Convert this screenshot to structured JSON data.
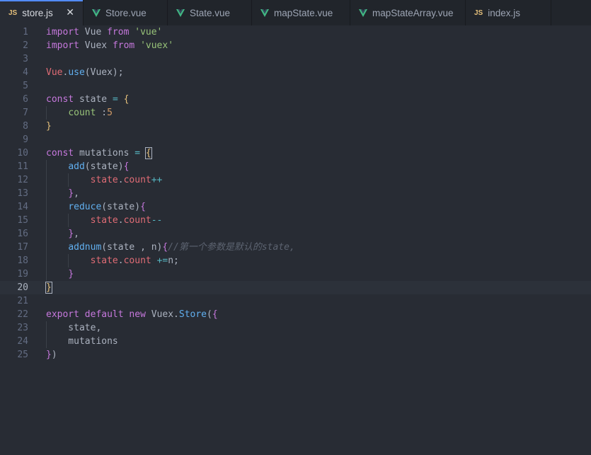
{
  "colors": {
    "editor_bg": "#282c34",
    "tabbar_bg": "#21252b",
    "keyword": "#c678dd",
    "string": "#98c379",
    "function": "#61afef",
    "property": "#e06c75",
    "number": "#d19a66",
    "operator": "#56b6c2",
    "comment": "#5c6370",
    "vue_green": "#41b883",
    "js_yellow": "#e5c07b"
  },
  "tabs": [
    {
      "label": "store.js",
      "icon": "js-icon",
      "icon_text": "JS",
      "active": true,
      "close_glyph": "✕"
    },
    {
      "label": "Store.vue",
      "icon": "vue-icon"
    },
    {
      "label": "State.vue",
      "icon": "vue-icon"
    },
    {
      "label": "mapState.vue",
      "icon": "vue-icon"
    },
    {
      "label": "mapStateArray.vue",
      "icon": "vue-icon"
    },
    {
      "label": "index.js",
      "icon": "js-icon",
      "icon_text": "JS"
    }
  ],
  "editor": {
    "current_line": 20,
    "lines": [
      {
        "n": "1",
        "tokens": [
          [
            "import",
            "keyword"
          ],
          [
            " Vue ",
            "plain"
          ],
          [
            "from",
            "keyword"
          ],
          [
            " ",
            "plain"
          ],
          [
            "'vue'",
            "string"
          ]
        ]
      },
      {
        "n": "2",
        "tokens": [
          [
            "import",
            "keyword"
          ],
          [
            " Vuex ",
            "plain"
          ],
          [
            "from",
            "keyword"
          ],
          [
            " ",
            "plain"
          ],
          [
            "'vuex'",
            "string"
          ]
        ]
      },
      {
        "n": "3",
        "tokens": []
      },
      {
        "n": "4",
        "tokens": [
          [
            "Vue",
            "prop"
          ],
          [
            ".",
            "plain"
          ],
          [
            "use",
            "func"
          ],
          [
            "(Vuex);",
            "plain"
          ]
        ]
      },
      {
        "n": "5",
        "tokens": []
      },
      {
        "n": "6",
        "tokens": [
          [
            "const",
            "keyword"
          ],
          [
            " state ",
            "plain"
          ],
          [
            "=",
            "op"
          ],
          [
            " ",
            "plain"
          ],
          [
            "{",
            "brace-yellow"
          ]
        ]
      },
      {
        "n": "7",
        "indent": 1,
        "tokens": [
          [
            "    ",
            "plain"
          ],
          [
            "count",
            "string"
          ],
          [
            " :",
            "plain"
          ],
          [
            "5",
            "number"
          ]
        ]
      },
      {
        "n": "8",
        "tokens": [
          [
            "}",
            "brace-yellow"
          ]
        ]
      },
      {
        "n": "9",
        "tokens": []
      },
      {
        "n": "10",
        "tokens": [
          [
            "const",
            "keyword"
          ],
          [
            " mutations ",
            "plain"
          ],
          [
            "=",
            "op"
          ],
          [
            " ",
            "plain"
          ],
          [
            "{",
            "brace-yellow"
          ]
        ]
      },
      {
        "n": "11",
        "indent": 1,
        "tokens": [
          [
            "    ",
            "plain"
          ],
          [
            "add",
            "func"
          ],
          [
            "(state)",
            "plain"
          ],
          [
            "{",
            "brace"
          ]
        ]
      },
      {
        "n": "12",
        "indent": 2,
        "tokens": [
          [
            "        ",
            "plain"
          ],
          [
            "state",
            "prop"
          ],
          [
            ".",
            "plain"
          ],
          [
            "count",
            "prop"
          ],
          [
            "++",
            "op"
          ]
        ]
      },
      {
        "n": "13",
        "indent": 1,
        "tokens": [
          [
            "    ",
            "plain"
          ],
          [
            "}",
            "brace"
          ],
          [
            ",",
            "plain"
          ]
        ]
      },
      {
        "n": "14",
        "indent": 1,
        "tokens": [
          [
            "    ",
            "plain"
          ],
          [
            "reduce",
            "func"
          ],
          [
            "(state)",
            "plain"
          ],
          [
            "{",
            "brace"
          ]
        ]
      },
      {
        "n": "15",
        "indent": 2,
        "tokens": [
          [
            "        ",
            "plain"
          ],
          [
            "state",
            "prop"
          ],
          [
            ".",
            "plain"
          ],
          [
            "count",
            "prop"
          ],
          [
            "--",
            "op"
          ]
        ]
      },
      {
        "n": "16",
        "indent": 1,
        "tokens": [
          [
            "    ",
            "plain"
          ],
          [
            "}",
            "brace"
          ],
          [
            ",",
            "plain"
          ]
        ]
      },
      {
        "n": "17",
        "indent": 1,
        "tokens": [
          [
            "    ",
            "plain"
          ],
          [
            "addnum",
            "func"
          ],
          [
            "(state , n)",
            "plain"
          ],
          [
            "{",
            "brace"
          ],
          [
            "//第一个参数是默认的state,",
            "comment"
          ]
        ]
      },
      {
        "n": "18",
        "indent": 2,
        "tokens": [
          [
            "        ",
            "plain"
          ],
          [
            "state",
            "prop"
          ],
          [
            ".",
            "plain"
          ],
          [
            "count",
            "prop"
          ],
          [
            " ",
            "plain"
          ],
          [
            "+=",
            "op"
          ],
          [
            "n;",
            "plain"
          ]
        ]
      },
      {
        "n": "19",
        "indent": 1,
        "tokens": [
          [
            "    ",
            "plain"
          ],
          [
            "}",
            "brace"
          ]
        ]
      },
      {
        "n": "20",
        "tokens": [
          [
            "}",
            "brace-yellow"
          ]
        ]
      },
      {
        "n": "21",
        "tokens": []
      },
      {
        "n": "22",
        "tokens": [
          [
            "export",
            "keyword"
          ],
          [
            " ",
            "plain"
          ],
          [
            "default",
            "keyword"
          ],
          [
            " ",
            "plain"
          ],
          [
            "new",
            "keyword"
          ],
          [
            " Vuex.",
            "plain"
          ],
          [
            "Store",
            "func"
          ],
          [
            "(",
            "plain"
          ],
          [
            "{",
            "brace"
          ]
        ]
      },
      {
        "n": "23",
        "indent": 1,
        "tokens": [
          [
            "    state,",
            "plain"
          ]
        ]
      },
      {
        "n": "24",
        "indent": 1,
        "tokens": [
          [
            "    mutations",
            "plain"
          ]
        ]
      },
      {
        "n": "25",
        "tokens": [
          [
            "}",
            "brace"
          ],
          [
            ")",
            "plain"
          ]
        ]
      }
    ]
  }
}
